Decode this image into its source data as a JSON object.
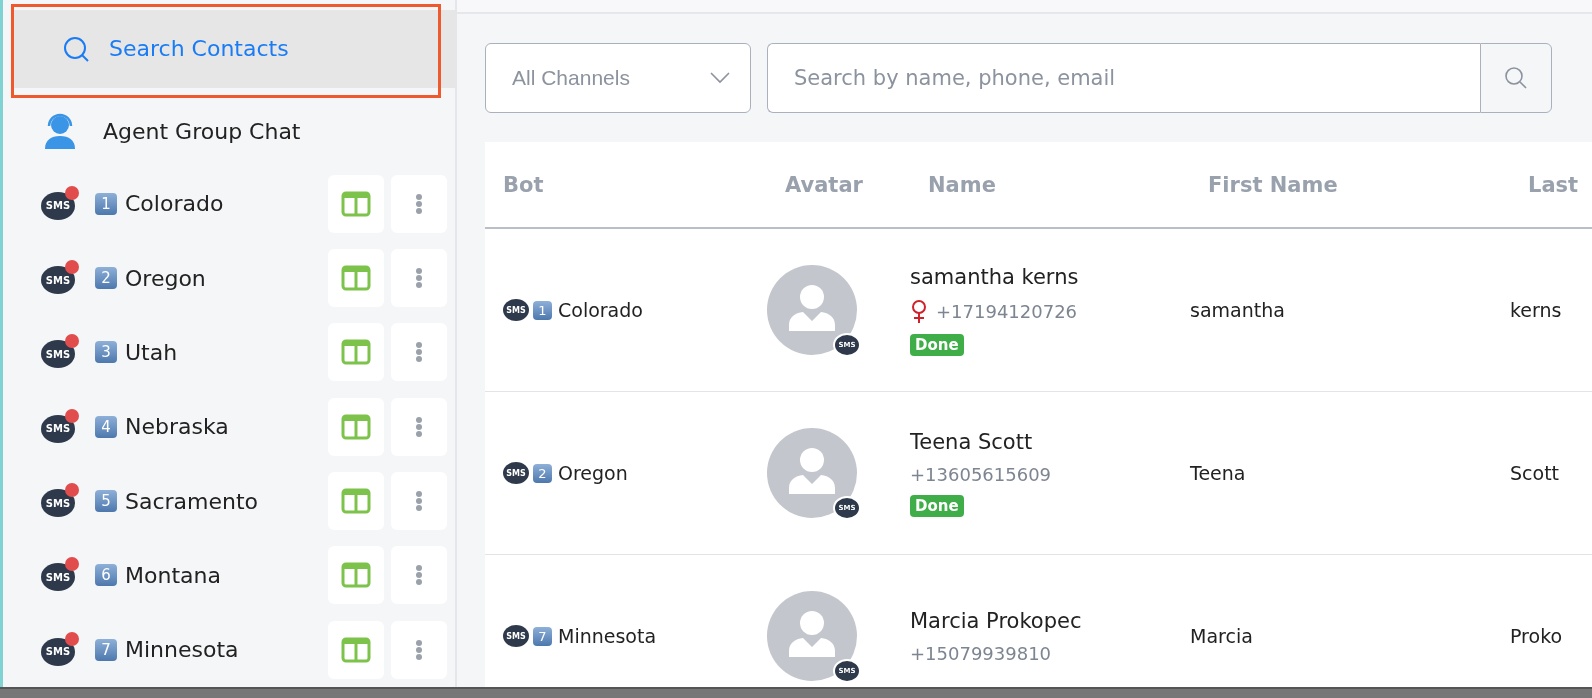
{
  "sidebar": {
    "search": {
      "label": "Search Contacts",
      "selected": true,
      "highlighted": true
    },
    "agent_chat": {
      "label": "Agent Group Chat"
    },
    "items": [
      {
        "number": "1",
        "name": "Colorado",
        "channel": "SMS",
        "unread": true
      },
      {
        "number": "2",
        "name": "Oregon",
        "channel": "SMS",
        "unread": true
      },
      {
        "number": "3",
        "name": "Utah",
        "channel": "SMS",
        "unread": true
      },
      {
        "number": "4",
        "name": "Nebraska",
        "channel": "SMS",
        "unread": true
      },
      {
        "number": "5",
        "name": "Sacramento",
        "channel": "SMS",
        "unread": true
      },
      {
        "number": "6",
        "name": "Montana",
        "channel": "SMS",
        "unread": true
      },
      {
        "number": "7",
        "name": "Minnesota",
        "channel": "SMS",
        "unread": true
      }
    ]
  },
  "filters": {
    "channel_dropdown": {
      "value": "All Channels"
    },
    "search": {
      "placeholder": "Search by name, phone, email"
    }
  },
  "table": {
    "columns": [
      "Bot",
      "Avatar",
      "Name",
      "First Name",
      "Last"
    ],
    "rows": [
      {
        "bot": {
          "channel": "SMS",
          "number": "1",
          "name": "Colorado"
        },
        "avatar_channel": "SMS",
        "name": "samantha kerns",
        "female": true,
        "phone": "+17194120726",
        "status": "Done",
        "first_name": "samantha",
        "last_name": "kerns"
      },
      {
        "bot": {
          "channel": "SMS",
          "number": "2",
          "name": "Oregon"
        },
        "avatar_channel": "SMS",
        "name": "Teena Scott",
        "female": false,
        "phone": "+13605615609",
        "status": "Done",
        "first_name": "Teena",
        "last_name": "Scott"
      },
      {
        "bot": {
          "channel": "SMS",
          "number": "7",
          "name": "Minnesota"
        },
        "avatar_channel": "SMS",
        "name": "Marcia Prokopec",
        "female": false,
        "phone": "+15079939810",
        "first_name": "Marcia",
        "last_name": "Proko"
      }
    ]
  }
}
